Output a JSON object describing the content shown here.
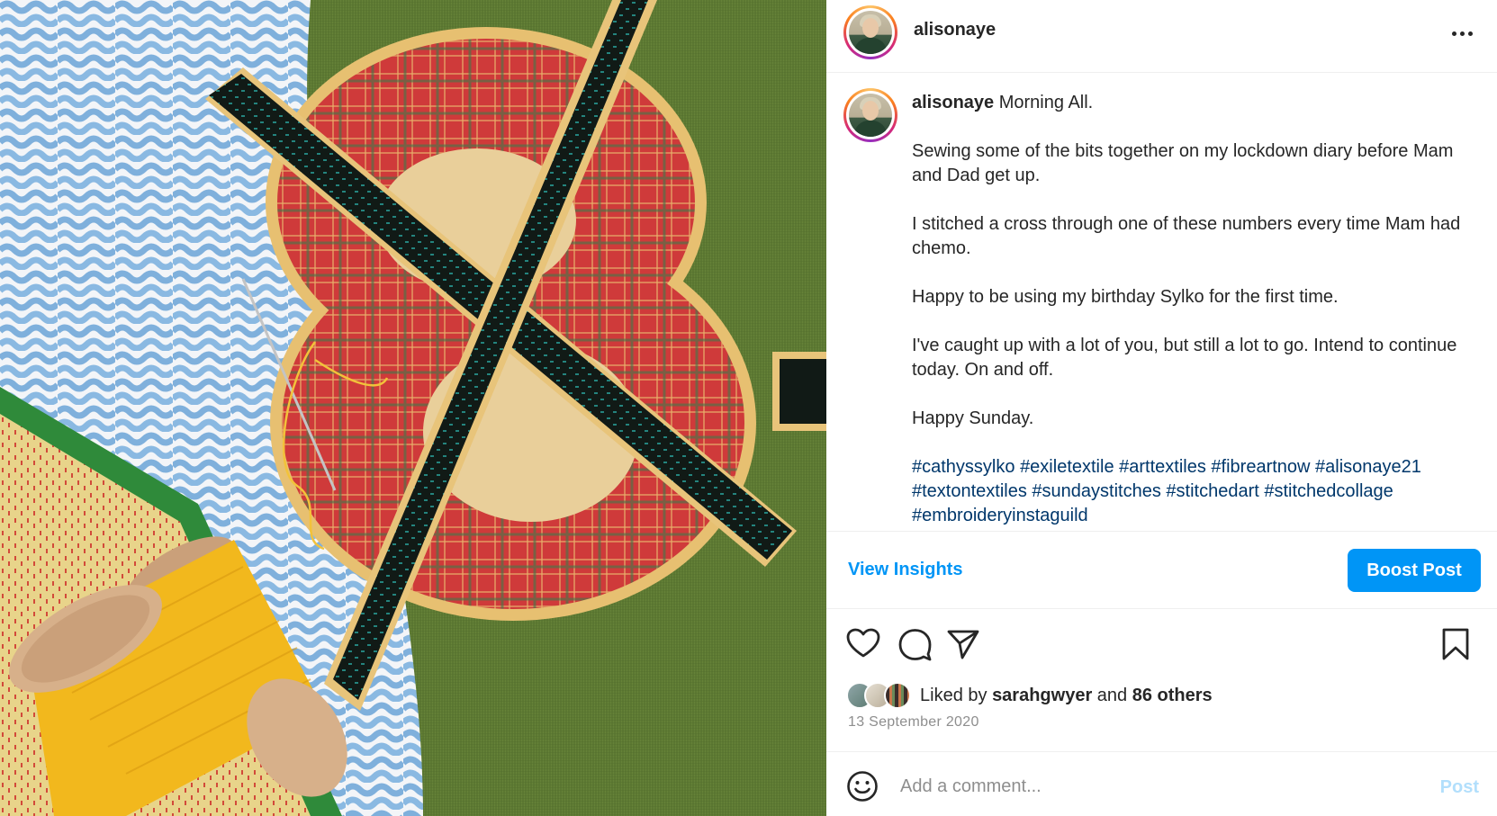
{
  "post": {
    "username": "alisonaye",
    "caption": {
      "username": "alisonaye",
      "intro": "Morning All.",
      "paragraphs": [
        "Sewing some of the bits together on my lockdown diary before Mam and Dad get up.",
        "I stitched a cross through one of these numbers every time Mam had chemo.",
        "Happy to be using my birthday Sylko for the first time.",
        "I've caught up with a lot of you, but still a lot to go. Intend to continue today. On and off.",
        "Happy Sunday."
      ],
      "hashtags": [
        "#cathyssylko",
        "#exiletextile",
        "#arttextiles",
        "#fibreartnow",
        "#alisonaye21",
        "#textontextiles",
        "#sundaystitches",
        "#stitchedart",
        "#stitchedcollage",
        "#embroideryinstaguild"
      ]
    },
    "insights_label": "View Insights",
    "boost_label": "Boost Post",
    "likes": {
      "prefix": "Liked by",
      "user": "sarahgwyer",
      "joiner": "and",
      "others": "86 others"
    },
    "date": "13 September 2020",
    "comment_placeholder": "Add a comment...",
    "post_label": "Post"
  },
  "icons": {
    "more": "more-options-icon",
    "like": "heart-icon",
    "comment": "comment-bubble-icon",
    "share": "paper-plane-icon",
    "save": "bookmark-icon",
    "emoji": "smiley-icon"
  },
  "colors": {
    "accent": "#0095f6",
    "hashtag": "#00376b",
    "text": "#262626",
    "muted": "#8e8e8e",
    "post_disabled": "#b2dffc"
  }
}
